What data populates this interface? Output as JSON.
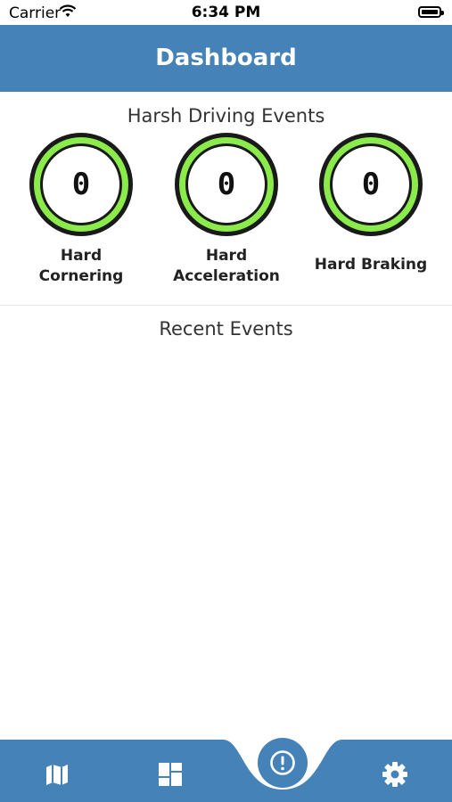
{
  "status_bar": {
    "carrier": "Carrier",
    "time": "6:34 PM"
  },
  "header": {
    "title": "Dashboard"
  },
  "harsh_events": {
    "title": "Harsh Driving Events",
    "items": [
      {
        "label_line1": "Hard",
        "label_line2": "Cornering",
        "value": "0"
      },
      {
        "label_line1": "Hard",
        "label_line2": "Acceleration",
        "value": "0"
      },
      {
        "label_line1": "Hard Braking",
        "label_line2": "",
        "value": "0"
      }
    ]
  },
  "recent_events": {
    "title": "Recent Events"
  },
  "tab_bar": {
    "items": [
      {
        "icon": "map-icon"
      },
      {
        "icon": "dashboard-icon"
      },
      {
        "icon": "alert-icon"
      },
      {
        "icon": "gear-icon"
      }
    ]
  },
  "colors": {
    "primary": "#4582b8",
    "ring_green": "#8aeb4b",
    "ring_dark": "#1a1a1a"
  }
}
